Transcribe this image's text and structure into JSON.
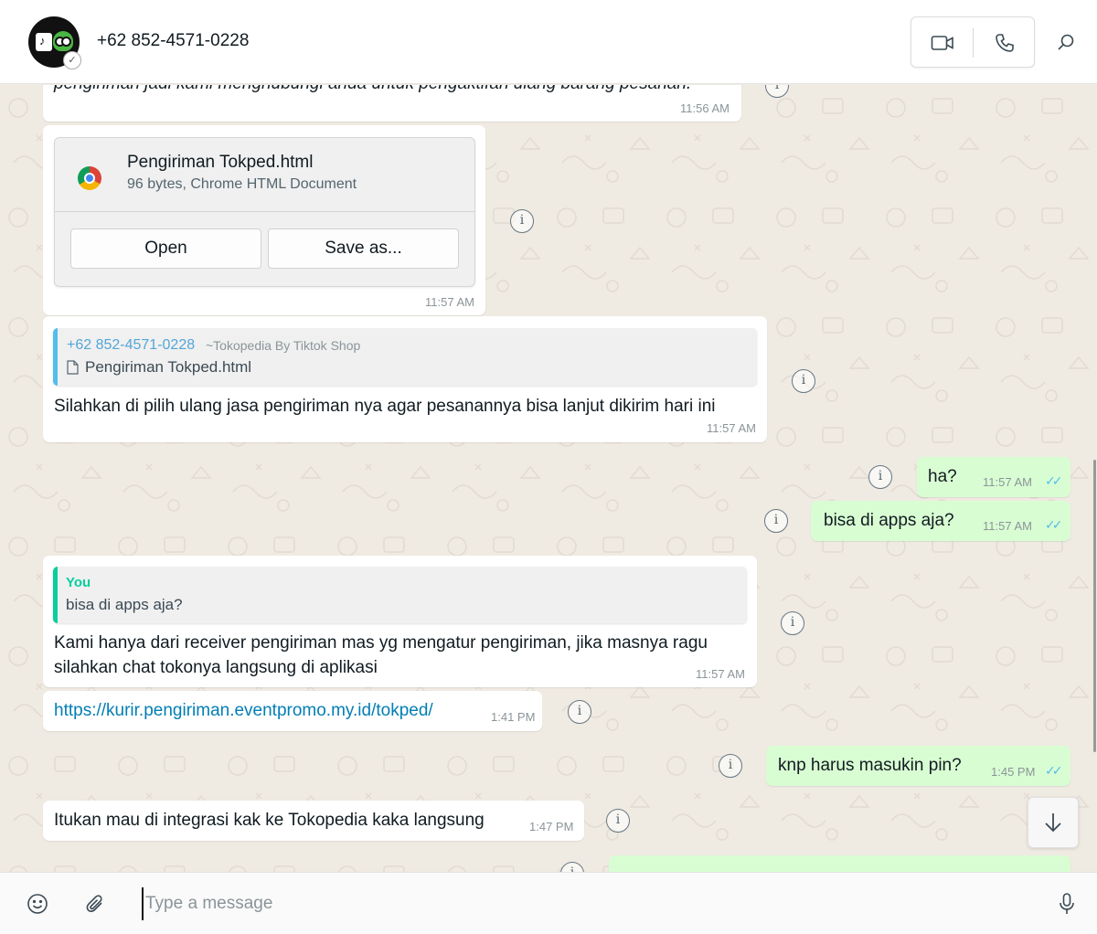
{
  "header": {
    "contact_name": "+62 852-4571-0228"
  },
  "messages": {
    "m0": {
      "text": "pengiriman jadi kami menghubungi anda untuk pengaktifan ulang barang pesanan.",
      "time": "11:56 AM"
    },
    "m1": {
      "file_name": "Pengiriman Tokped.html",
      "file_meta": "96 bytes, Chrome HTML Document",
      "open_label": "Open",
      "save_label": "Save as...",
      "time": "11:57 AM"
    },
    "m2": {
      "quote_sender": "+62 852-4571-0228",
      "quote_pushname": "~Tokopedia By Tiktok Shop",
      "quote_file": "Pengiriman Tokped.html",
      "text": "Silahkan di pilih ulang jasa pengiriman nya agar pesanannya bisa lanjut dikirim hari ini",
      "time": "11:57 AM"
    },
    "m3": {
      "text": "ha?",
      "time": "11:57 AM"
    },
    "m4": {
      "text": "bisa di apps aja?",
      "time": "11:57 AM"
    },
    "m5": {
      "quote_sender": "You",
      "quote_text": "bisa di apps aja?",
      "line1": "Kami hanya dari receiver pengiriman mas yg mengatur pengiriman, jika masnya ragu",
      "line2": "silahkan chat tokonya langsung di aplikasi",
      "time": "11:57 AM"
    },
    "m6": {
      "link": "https://kurir.pengiriman.eventpromo.my.id/tokped/",
      "time": "1:41 PM"
    },
    "m7": {
      "text": "knp harus masukin pin?",
      "time": "1:45 PM"
    },
    "m8": {
      "text": "Itukan mau di integrasi kak ke Tokopedia kaka langsung",
      "time": "1:47 PM"
    }
  },
  "composer": {
    "placeholder": "Type a message"
  },
  "colors": {
    "outgoing_bubble": "#d9fdd3",
    "incoming_bubble": "#ffffff",
    "chat_background": "#efeae2",
    "read_ticks": "#53bdeb",
    "quote_bar_contact": "#53bdeb",
    "quote_bar_you": "#06cf9c",
    "link": "#027eb5"
  },
  "icons": [
    "video-call-icon",
    "voice-call-icon",
    "search-icon",
    "info-icon",
    "chrome-icon",
    "document-icon",
    "double-check-icon",
    "arrow-down-icon",
    "emoji-icon",
    "attach-icon",
    "microphone-icon"
  ]
}
